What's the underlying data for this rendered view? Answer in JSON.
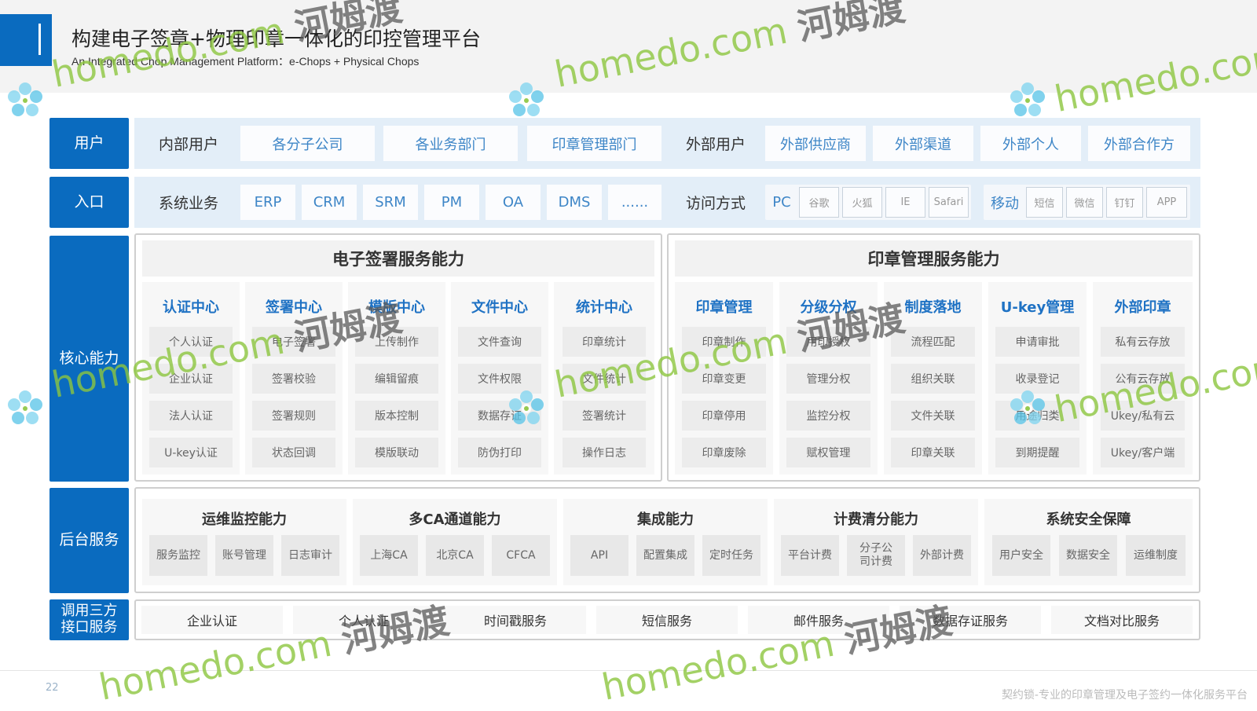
{
  "header": {
    "title": "构建电子签章+物理印章一体化的印控管理平台",
    "subtitle": "An Integrated Chop Management Platform：e-Chops + Physical Chops"
  },
  "rows": {
    "user": {
      "label": "用户",
      "internal_label": "内部用户",
      "internal_items": [
        "各分子公司",
        "各业务部门",
        "印章管理部门"
      ],
      "external_label": "外部用户",
      "external_items": [
        "外部供应商",
        "外部渠道",
        "外部个人",
        "外部合作方"
      ]
    },
    "entry": {
      "label": "入口",
      "system_label": "系统业务",
      "systems": [
        "ERP",
        "CRM",
        "SRM",
        "PM",
        "OA",
        "DMS",
        "......"
      ],
      "access_label": "访问方式",
      "pc_label": "PC",
      "pc_items": [
        "谷歌",
        "火狐",
        "IE",
        "Safari"
      ],
      "mobile_label": "移动",
      "mobile_items": [
        "短信",
        "微信",
        "钉钉",
        "APP"
      ]
    },
    "core": {
      "label": "核心能力",
      "esign": {
        "title": "电子签署服务能力",
        "columns": [
          {
            "title": "认证中心",
            "items": [
              "个人认证",
              "企业认证",
              "法人认证",
              "U-key认证"
            ]
          },
          {
            "title": "签署中心",
            "items": [
              "电子签署",
              "签署校验",
              "签署规则",
              "状态回调"
            ]
          },
          {
            "title": "模版中心",
            "items": [
              "上传制作",
              "编辑留痕",
              "版本控制",
              "模版联动"
            ]
          },
          {
            "title": "文件中心",
            "items": [
              "文件查询",
              "文件权限",
              "数据存证",
              "防伪打印"
            ]
          },
          {
            "title": "统计中心",
            "items": [
              "印章统计",
              "文件统计",
              "签署统计",
              "操作日志"
            ]
          }
        ]
      },
      "seal": {
        "title": "印章管理服务能力",
        "columns": [
          {
            "title": "印章管理",
            "items": [
              "印章制作",
              "印章变更",
              "印章停用",
              "印章废除"
            ]
          },
          {
            "title": "分级分权",
            "items": [
              "用印授权",
              "管理分权",
              "监控分权",
              "赋权管理"
            ]
          },
          {
            "title": "制度落地",
            "items": [
              "流程匹配",
              "组织关联",
              "文件关联",
              "印章关联"
            ]
          },
          {
            "title": "U-key管理",
            "items": [
              "申请审批",
              "收录登记",
              "用途归类",
              "到期提醒"
            ]
          },
          {
            "title": "外部印章",
            "items": [
              "私有云存放",
              "公有云存放",
              "Ukey/私有云",
              "Ukey/客户端"
            ]
          }
        ]
      }
    },
    "backend": {
      "label": "后台服务",
      "groups": [
        {
          "title": "运维监控能力",
          "items": [
            "服务监控",
            "账号管理",
            "日志审计"
          ]
        },
        {
          "title": "多CA通道能力",
          "items": [
            "上海CA",
            "北京CA",
            "CFCA"
          ]
        },
        {
          "title": "集成能力",
          "items": [
            "API",
            "配置集成",
            "定时任务"
          ]
        },
        {
          "title": "计费清分能力",
          "items": [
            "平台计费",
            "分子公司计费",
            "外部计费"
          ]
        },
        {
          "title": "系统安全保障",
          "items": [
            "用户安全",
            "数据安全",
            "运维制度"
          ]
        }
      ]
    },
    "third_party": {
      "label": "调用三方接口服务",
      "items": [
        "企业认证",
        "个人认证",
        "时间戳服务",
        "短信服务",
        "邮件服务",
        "数据存证服务",
        "文档对比服务"
      ]
    }
  },
  "watermark": {
    "brand": "homedo.com",
    "cn": "河姆渡"
  },
  "footer": {
    "page_number": "22",
    "text": "契约锁-专业的印章管理及电子签约一体化服务平台"
  },
  "colors": {
    "brand_blue": "#0a6bbf",
    "link_blue": "#3e86c7",
    "row_bg": "#e3eef8"
  }
}
